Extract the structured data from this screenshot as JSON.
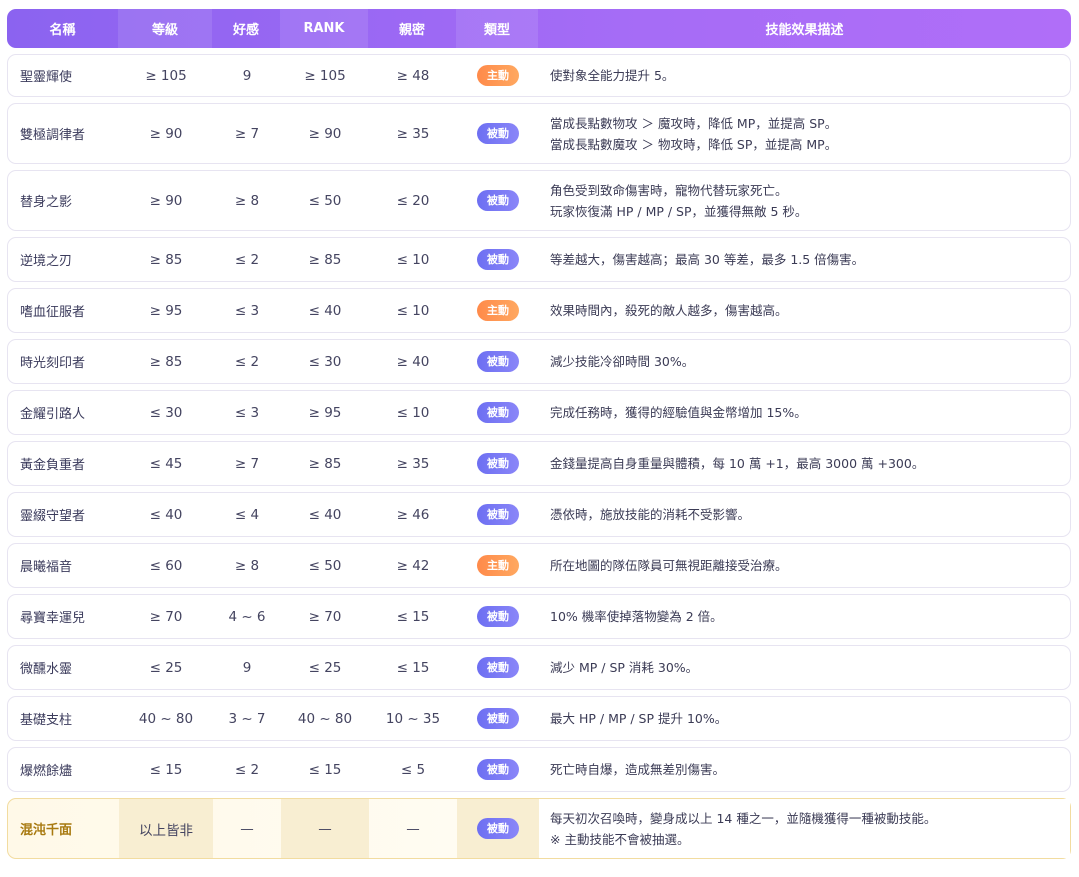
{
  "headers": {
    "name": "名稱",
    "level": "等級",
    "favor": "好感",
    "rank": "RANK",
    "intimacy": "親密",
    "type": "類型",
    "desc": "技能效果描述"
  },
  "colors": {
    "header_start": "#8b63f0",
    "header_end": "#b06ef8",
    "active_badge": "#ff8a4a",
    "passive_badge": "#6d6ff2",
    "special_row_bg": "#fff9e8",
    "special_name": "#a87a10"
  },
  "rows": [
    {
      "name": "聖靈輝使",
      "level": "≥ 105",
      "favor": "9",
      "rank": "≥ 105",
      "intimacy": "≥ 48",
      "type": "主動",
      "type_kind": "active",
      "desc": [
        "使對象全能力提升 5。"
      ]
    },
    {
      "name": "雙極調律者",
      "level": "≥ 90",
      "favor": "≥ 7",
      "rank": "≥ 90",
      "intimacy": "≥ 35",
      "type": "被動",
      "type_kind": "passive",
      "desc": [
        "當成長點數物攻 ＞ 魔攻時，降低 MP，並提高 SP。",
        "當成長點數魔攻 ＞ 物攻時，降低 SP，並提高 MP。"
      ]
    },
    {
      "name": "替身之影",
      "level": "≥ 90",
      "favor": "≥ 8",
      "rank": "≤ 50",
      "intimacy": "≤ 20",
      "type": "被動",
      "type_kind": "passive",
      "desc": [
        "角色受到致命傷害時，寵物代替玩家死亡。",
        "玩家恢復滿 HP / MP / SP，並獲得無敵 5 秒。"
      ]
    },
    {
      "name": "逆境之刃",
      "level": "≥ 85",
      "favor": "≤ 2",
      "rank": "≥ 85",
      "intimacy": "≤ 10",
      "type": "被動",
      "type_kind": "passive",
      "desc": [
        "等差越大，傷害越高；最高 30 等差，最多 1.5 倍傷害。"
      ]
    },
    {
      "name": "嗜血征服者",
      "level": "≥ 95",
      "favor": "≤ 3",
      "rank": "≤ 40",
      "intimacy": "≤ 10",
      "type": "主動",
      "type_kind": "active",
      "desc": [
        "效果時間內，殺死的敵人越多，傷害越高。"
      ]
    },
    {
      "name": "時光刻印者",
      "level": "≥ 85",
      "favor": "≤ 2",
      "rank": "≤ 30",
      "intimacy": "≥ 40",
      "type": "被動",
      "type_kind": "passive",
      "desc": [
        "減少技能冷卻時間 30%。"
      ]
    },
    {
      "name": "金耀引路人",
      "level": "≤ 30",
      "favor": "≤ 3",
      "rank": "≥ 95",
      "intimacy": "≤ 10",
      "type": "被動",
      "type_kind": "passive",
      "desc": [
        "完成任務時，獲得的經驗值與金幣增加 15%。"
      ]
    },
    {
      "name": "黃金負重者",
      "level": "≤ 45",
      "favor": "≥ 7",
      "rank": "≥ 85",
      "intimacy": "≥ 35",
      "type": "被動",
      "type_kind": "passive",
      "desc": [
        "金錢量提高自身重量與體積，每 10 萬 +1，最高 3000 萬 +300。"
      ]
    },
    {
      "name": "靈綴守望者",
      "level": "≤ 40",
      "favor": "≤ 4",
      "rank": "≤ 40",
      "intimacy": "≥ 46",
      "type": "被動",
      "type_kind": "passive",
      "desc": [
        "憑依時，施放技能的消耗不受影響。"
      ]
    },
    {
      "name": "晨曦福音",
      "level": "≤ 60",
      "favor": "≥ 8",
      "rank": "≤ 50",
      "intimacy": "≥ 42",
      "type": "主動",
      "type_kind": "active",
      "desc": [
        "所在地圖的隊伍隊員可無視距離接受治療。"
      ]
    },
    {
      "name": "尋寶幸運兒",
      "level": "≥ 70",
      "favor": "4 ~ 6",
      "rank": "≥ 70",
      "intimacy": "≤ 15",
      "type": "被動",
      "type_kind": "passive",
      "desc": [
        "10% 機率使掉落物變為 2 倍。"
      ]
    },
    {
      "name": "微醺水靈",
      "level": "≤ 25",
      "favor": "9",
      "rank": "≤ 25",
      "intimacy": "≤ 15",
      "type": "被動",
      "type_kind": "passive",
      "desc": [
        "減少 MP / SP 消耗 30%。"
      ]
    },
    {
      "name": "基礎支柱",
      "level": "40 ~ 80",
      "favor": "3 ~ 7",
      "rank": "40 ~ 80",
      "intimacy": "10 ~ 35",
      "type": "被動",
      "type_kind": "passive",
      "desc": [
        "最大 HP / MP / SP 提升 10%。"
      ]
    },
    {
      "name": "爆燃餘燼",
      "level": "≤ 15",
      "favor": "≤ 2",
      "rank": "≤ 15",
      "intimacy": "≤ 5",
      "type": "被動",
      "type_kind": "passive",
      "desc": [
        "死亡時自爆，造成無差別傷害。"
      ]
    },
    {
      "name": "混沌千面",
      "level": "以上皆非",
      "favor": "—",
      "rank": "—",
      "intimacy": "—",
      "type": "被動",
      "type_kind": "passive",
      "special": true,
      "desc": [
        "每天初次召喚時，變身成以上 14 種之一，並隨機獲得一種被動技能。",
        "※ 主動技能不會被抽選。"
      ]
    }
  ]
}
